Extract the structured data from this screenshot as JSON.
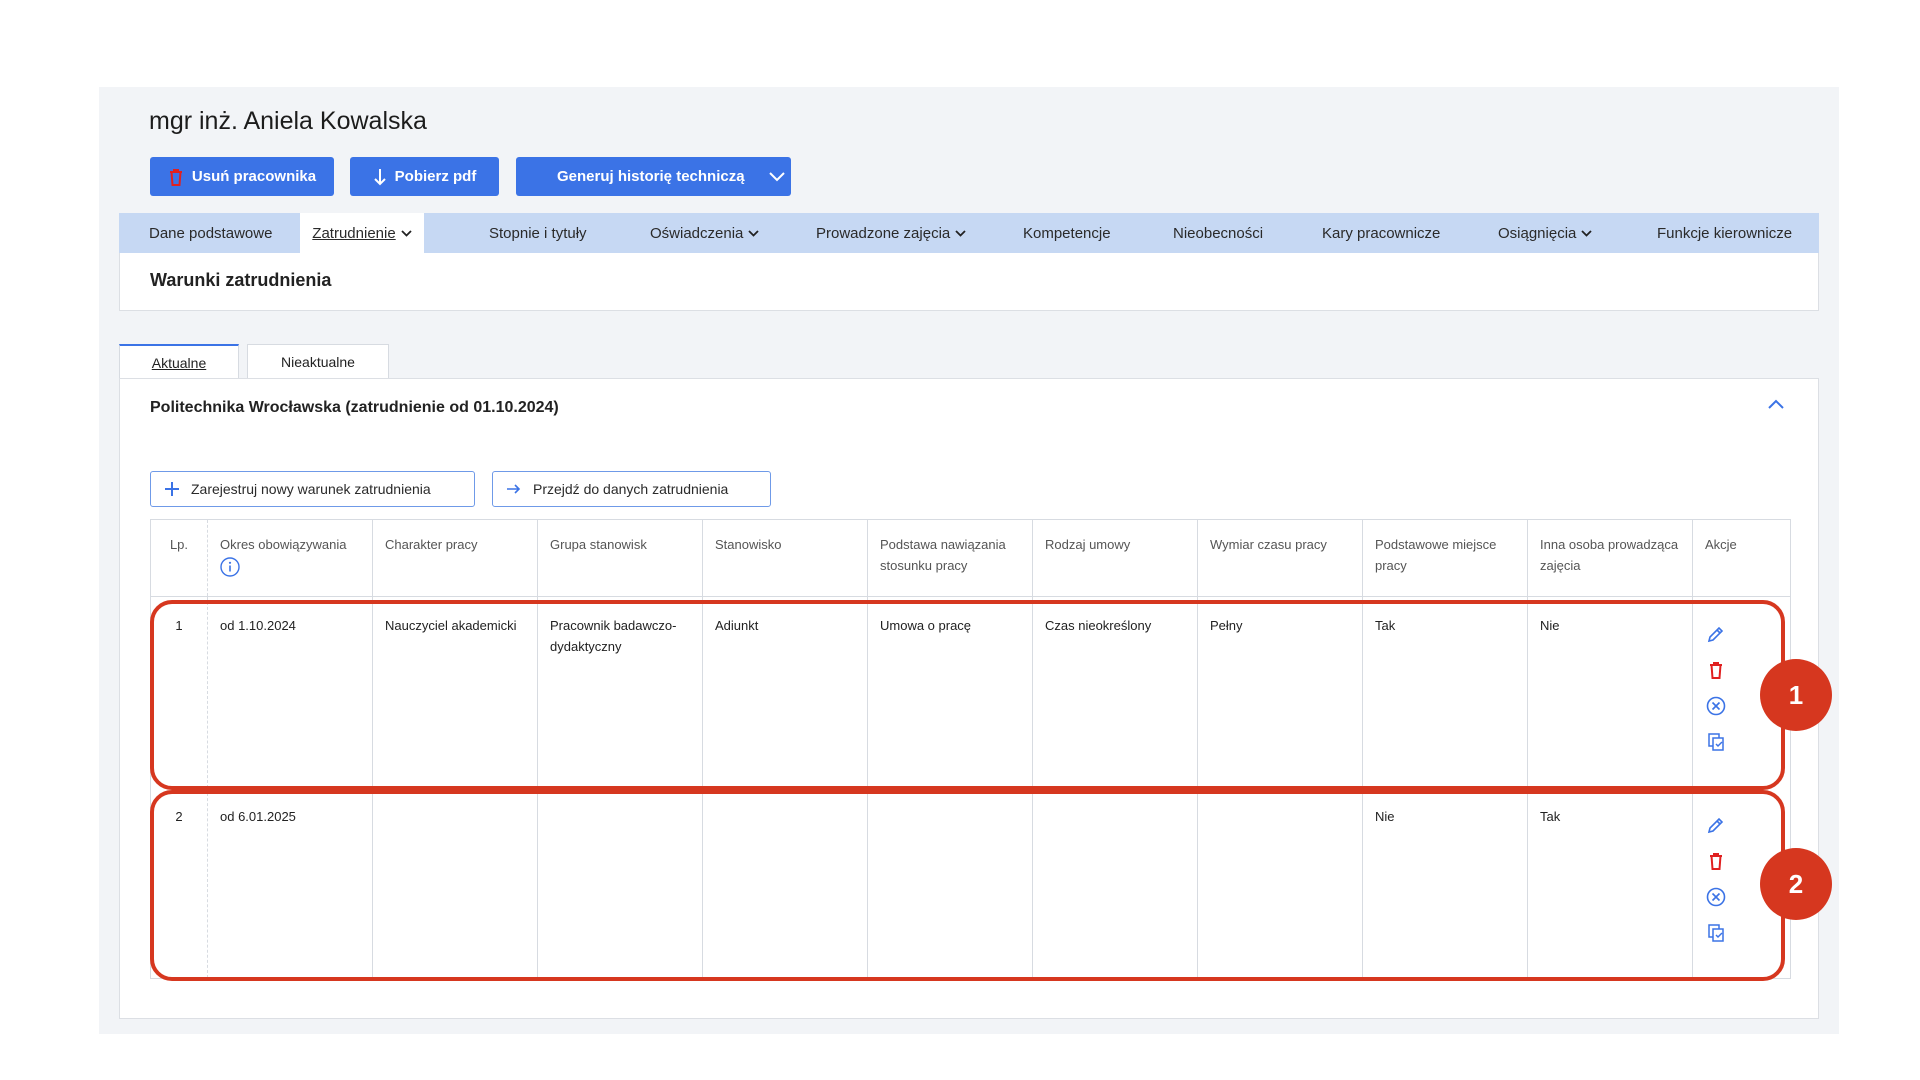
{
  "employee": {
    "name": "mgr inż. Aniela Kowalska"
  },
  "toolbar": {
    "delete_label": "Usuń pracownika",
    "pdf_label": "Pobierz pdf",
    "generate_label": "Generuj historię techniczą"
  },
  "nav": {
    "tabs": [
      {
        "label": "Dane podstawowe"
      },
      {
        "label": "Zatrudnienie",
        "active": true,
        "dropdown": true
      },
      {
        "label": "Stopnie i tytuły"
      },
      {
        "label": "Oświadczenia",
        "dropdown": true
      },
      {
        "label": "Prowadzone zajęcia",
        "dropdown": true
      },
      {
        "label": "Kompetencje"
      },
      {
        "label": "Nieobecności"
      },
      {
        "label": "Kary pracownicze"
      },
      {
        "label": "Osiągnięcia",
        "dropdown": true
      },
      {
        "label": "Funkcje kierownicze"
      }
    ]
  },
  "section": {
    "title": "Warunki zatrudnienia"
  },
  "subtabs": [
    {
      "label": "Aktualne",
      "active": true
    },
    {
      "label": "Nieaktualne"
    }
  ],
  "employer": {
    "title": "Politechnika Wrocławska (zatrudnienie od 01.10.2024)",
    "register_label": "Zarejestruj nowy warunek zatrudnienia",
    "goto_label": "Przejdź do danych zatrudnienia"
  },
  "table": {
    "headers": [
      "Lp.",
      "Okres obowiązywania",
      "Charakter pracy",
      "Grupa stanowisk",
      "Stanowisko",
      "Podstawa nawiązania stosunku pracy",
      "Rodzaj umowy",
      "Wymiar czasu pracy",
      "Podstawowe miejsce pracy",
      "Inna osoba prowadząca zajęcia",
      "Akcje"
    ],
    "rows": [
      [
        "1",
        "od 1.10.2024",
        "Nauczyciel akademicki",
        "Pracownik badawczo-dydaktyczny",
        "Adiunkt",
        "Umowa o pracę",
        "Czas nieokreślony",
        "Pełny",
        "Tak",
        "Nie"
      ],
      [
        "2",
        "od 6.01.2025",
        "",
        "",
        "",
        "",
        "",
        "",
        "Nie",
        "Tak"
      ]
    ],
    "row_actions": [
      "edit-icon",
      "delete-icon",
      "cancel-icon",
      "copy-icon"
    ]
  },
  "callouts": [
    "1",
    "2"
  ],
  "colors": {
    "primary": "#3b73e6",
    "nav_bg": "#c6d8f3",
    "danger": "#d6371f",
    "panel_bg": "#f2f4f7"
  }
}
